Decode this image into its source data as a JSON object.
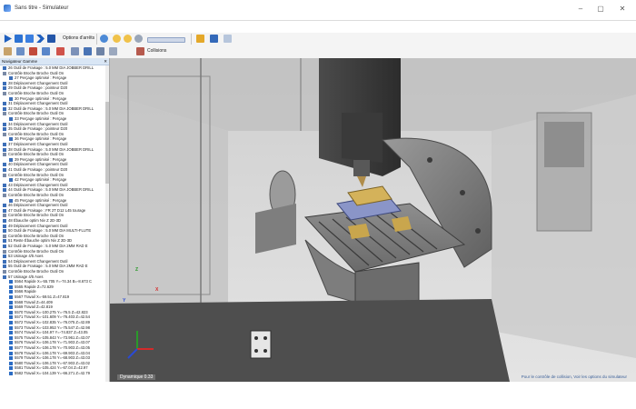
{
  "window": {
    "title": "Sans titre - Simulateur",
    "minimize": "–",
    "maximize": "▢",
    "close": "✕"
  },
  "toolbar1": {
    "options_label": "Options d'arrêts"
  },
  "toolbar2": {
    "collisions_label": "Collisions"
  },
  "navigator": {
    "title": "Navigateur Gamme",
    "close": "✕",
    "rows": [
      {
        "indent": 1,
        "icon": "op",
        "text": "26 Outil de Fraisage : 5.0 MM DIA JOBBER DRILL"
      },
      {
        "indent": 1,
        "icon": "sub",
        "text": "Contrôle Broche Broche Outil On"
      },
      {
        "indent": 2,
        "icon": "op",
        "text": "27 Perçage optimisé : Perçage"
      },
      {
        "indent": 1,
        "icon": "op",
        "text": "28 Déplacement Changement Outil"
      },
      {
        "indent": 1,
        "icon": "op",
        "text": "29 Outil de Fraisage : pointeur D20"
      },
      {
        "indent": 1,
        "icon": "sub",
        "text": "Contrôle Broche Broche Outil On"
      },
      {
        "indent": 2,
        "icon": "op",
        "text": "30 Perçage optimisé : Perçage"
      },
      {
        "indent": 1,
        "icon": "op",
        "text": "31 Déplacement Changement Outil"
      },
      {
        "indent": 1,
        "icon": "op",
        "text": "32 Outil de Fraisage : 5.0 MM DIA JOBBER DRILL"
      },
      {
        "indent": 1,
        "icon": "sub",
        "text": "Contrôle Broche Broche Outil On"
      },
      {
        "indent": 2,
        "icon": "op",
        "text": "33 Perçage optimisé : Perçage"
      },
      {
        "indent": 1,
        "icon": "op",
        "text": "34 Déplacement Changement Outil"
      },
      {
        "indent": 1,
        "icon": "op",
        "text": "35 Outil de Fraisage : pointeur D20"
      },
      {
        "indent": 1,
        "icon": "sub",
        "text": "Contrôle Broche Broche Outil On"
      },
      {
        "indent": 2,
        "icon": "op",
        "text": "36 Perçage optimisé : Perçage"
      },
      {
        "indent": 1,
        "icon": "op",
        "text": "37 Déplacement Changement Outil"
      },
      {
        "indent": 1,
        "icon": "op",
        "text": "38 Outil de Fraisage : 5.0 MM DIA JOBBER DRILL"
      },
      {
        "indent": 1,
        "icon": "sub",
        "text": "Contrôle Broche Broche Outil On"
      },
      {
        "indent": 2,
        "icon": "op",
        "text": "39 Perçage optimisé : Perçage"
      },
      {
        "indent": 1,
        "icon": "op",
        "text": "40 Déplacement Changement Outil"
      },
      {
        "indent": 1,
        "icon": "op",
        "text": "41 Outil de Fraisage : pointeur D20"
      },
      {
        "indent": 1,
        "icon": "sub",
        "text": "Contrôle Broche Broche Outil On"
      },
      {
        "indent": 2,
        "icon": "op",
        "text": "42 Perçage optimisé : Perçage"
      },
      {
        "indent": 1,
        "icon": "op",
        "text": "43 Déplacement Changement Outil"
      },
      {
        "indent": 1,
        "icon": "op",
        "text": "44 Outil de Fraisage : 5.0 MM DIA JOBBER DRILL"
      },
      {
        "indent": 1,
        "icon": "sub",
        "text": "Contrôle Broche Broche Outil On"
      },
      {
        "indent": 2,
        "icon": "op",
        "text": "45 Perçage optimisé : Perçage"
      },
      {
        "indent": 1,
        "icon": "op",
        "text": "46 Déplacement Changement Outil"
      },
      {
        "indent": 1,
        "icon": "op",
        "text": "47 Outil de Fraisage : FR 2T D12 L45 tourage"
      },
      {
        "indent": 1,
        "icon": "sub",
        "text": "Contrôle Broche Broche Outil On"
      },
      {
        "indent": 1,
        "icon": "op",
        "text": "48 Ébauche optim Niv Z 2D-3D"
      },
      {
        "indent": 1,
        "icon": "op",
        "text": "49 Déplacement Changement Outil"
      },
      {
        "indent": 1,
        "icon": "op",
        "text": "50 Outil de Fraisage : 5.0 MM DIA MULTI-FLUTE"
      },
      {
        "indent": 1,
        "icon": "sub",
        "text": "Contrôle Broche Broche Outil On"
      },
      {
        "indent": 1,
        "icon": "op",
        "text": "51 Reste Ébauche optim Niv Z 2D-3D"
      },
      {
        "indent": 1,
        "icon": "op",
        "text": "52 Outil de Fraisage : 5.0 MM DIA 2MM RAD E"
      },
      {
        "indent": 1,
        "icon": "sub",
        "text": "Contrôle Broche Broche Outil On"
      },
      {
        "indent": 1,
        "icon": "op",
        "text": "53 Usinage 4/5 Axes"
      },
      {
        "indent": 1,
        "icon": "op",
        "text": "54 Déplacement Changement Outil"
      },
      {
        "indent": 1,
        "icon": "op",
        "text": "55 Outil de Fraisage : 5.0 MM DIA 2MM RAD E"
      },
      {
        "indent": 1,
        "icon": "sub",
        "text": "Contrôle Broche Broche Outil On"
      },
      {
        "indent": 1,
        "icon": "op",
        "text": "57 Usinage 4/5 Axes"
      },
      {
        "indent": 2,
        "icon": "move",
        "text": "5564 Rapide X=-55.705 Y=-74.34 B=-8.673 C"
      },
      {
        "indent": 2,
        "icon": "move",
        "text": "5565 Rapide Z=72.629"
      },
      {
        "indent": 2,
        "icon": "move",
        "text": "5566 Rapide"
      },
      {
        "indent": 2,
        "icon": "move",
        "text": "5567 Travail X=-59.51 Z=47.819"
      },
      {
        "indent": 2,
        "icon": "move",
        "text": "5568 Travail Z=44.409"
      },
      {
        "indent": 2,
        "icon": "move",
        "text": "5569 Travail Z=42.819"
      },
      {
        "indent": 2,
        "icon": "move",
        "text": "5570 Travail X=-100.275 Y=-76.5 Z=42.823"
      },
      {
        "indent": 2,
        "icon": "move",
        "text": "5571 Travail X=-101.609 Y=-76.403 Z=42.54"
      },
      {
        "indent": 2,
        "icon": "move",
        "text": "5572 Travail X=-102.835 Y=-76.075 Z=42.89"
      },
      {
        "indent": 2,
        "icon": "move",
        "text": "5573 Travail X=-103.953 Y=-75.547 Z=42.98"
      },
      {
        "indent": 2,
        "icon": "move",
        "text": "5574 Travail X=-104.97 Y=-74.837 Z=43.05"
      },
      {
        "indent": 2,
        "icon": "move",
        "text": "5575 Travail X=-105.843 Y=-73.961 Z=43.07"
      },
      {
        "indent": 2,
        "icon": "move",
        "text": "5576 Travail X=-106.178 Y=-71.903 Z=43.07"
      },
      {
        "indent": 2,
        "icon": "move",
        "text": "5577 Travail X=-106.178 Y=-70.903 Z=43.05"
      },
      {
        "indent": 2,
        "icon": "move",
        "text": "5578 Travail X=-106.178 Y=-69.903 Z=43.04"
      },
      {
        "indent": 2,
        "icon": "move",
        "text": "5579 Travail X=-106.178 Y=-68.903 Z=43.03"
      },
      {
        "indent": 2,
        "icon": "move",
        "text": "5580 Travail X=-106.178 Y=-67.903 Z=43.02"
      },
      {
        "indent": 2,
        "icon": "move",
        "text": "5581 Travail X=-105.424 Y=-67.04 Z=42.97"
      },
      {
        "indent": 2,
        "icon": "move",
        "text": "5582 Travail X=-104.139 Y=-66.271 Z=42.79"
      }
    ]
  },
  "viewport": {
    "view_mode": "Dynamique 0.33",
    "axes": {
      "x": "X",
      "y": "Y",
      "z": "Z"
    }
  },
  "status": {
    "message": "Pour le contrôle de collision, Voir les options du simulateur"
  },
  "colors": {
    "toolbar_bg": "#f4f4f4",
    "viewport_bg": "#d7d7d7",
    "accent": "#2b6cc4",
    "table_blue": "#8a95c8",
    "part_gold": "#d4b25a"
  }
}
